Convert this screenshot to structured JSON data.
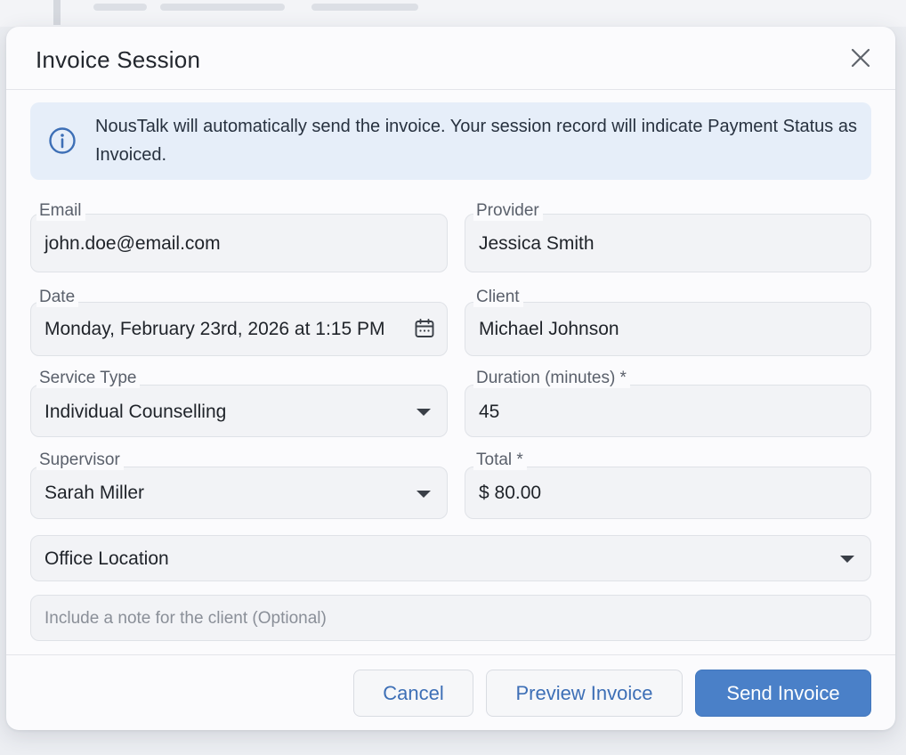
{
  "dialog": {
    "title": "Invoice Session",
    "info": "NousTalk will automatically send the invoice. Your session record will indicate Payment Status as Invoiced."
  },
  "fields": {
    "email": {
      "label": "Email",
      "value": "john.doe@email.com"
    },
    "provider": {
      "label": "Provider",
      "value": "Jessica Smith"
    },
    "date": {
      "label": "Date",
      "value": "Monday, February 23rd, 2026 at 1:15 PM"
    },
    "client": {
      "label": "Client",
      "value": "Michael Johnson"
    },
    "service_type": {
      "label": "Service Type",
      "value": "Individual Counselling"
    },
    "duration": {
      "label": "Duration (minutes) *",
      "value": "45"
    },
    "supervisor": {
      "label": "Supervisor",
      "value": "Sarah Miller"
    },
    "total": {
      "label": "Total *",
      "value": "$ 80.00"
    },
    "office_location": {
      "placeholder": "Office Location"
    },
    "note": {
      "placeholder": "Include a note for the client (Optional)"
    }
  },
  "buttons": {
    "cancel": "Cancel",
    "preview": "Preview Invoice",
    "send": "Send Invoice"
  },
  "icons": {
    "close": "close-icon",
    "info": "info-icon",
    "calendar": "calendar-icon",
    "dropdown": "chevron-down-icon"
  },
  "colors": {
    "primary": "#4a80c8",
    "info_bg": "#e6eef9",
    "info_icon": "#3d6fb6"
  }
}
